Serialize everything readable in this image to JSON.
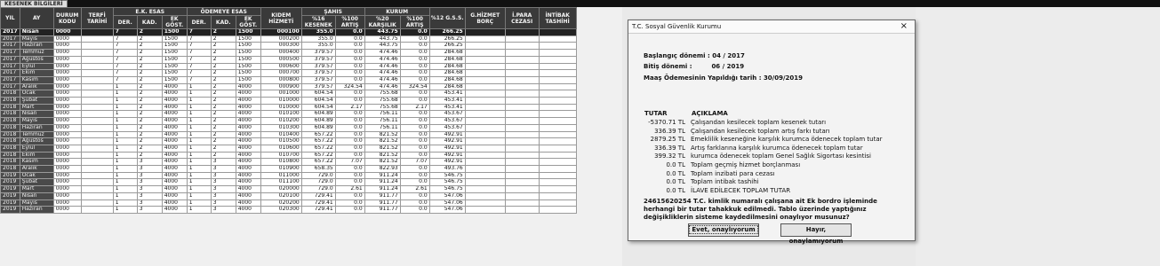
{
  "tab_label": "KESENEK BİLGİLERİ",
  "grid": {
    "group_headers": {
      "ek_esas": "E.K. ESAS",
      "odemeye_esas": "ÖDEMEYE ESAS",
      "sahis": "ŞAHIS",
      "kurum": "KURUM"
    },
    "columns": [
      "YIL",
      "AY",
      "DURUM KODU",
      "TERFİ TARİHİ",
      "DER.",
      "KAD.",
      "EK GÖST.",
      "DER.",
      "KAD.",
      "EK GÖST.",
      "KIDEM HİZMETİ",
      "%16 KESENEK",
      "%100 ARTIŞ",
      "%20 KARŞILIK",
      "%100 ARTIŞ",
      "%12 G.S.S.",
      "G.HİZMET BORÇ",
      "İ.PARA CEZASI",
      "İNTİBAK TASHİHİ"
    ],
    "rows": [
      [
        "2017",
        "Nisan",
        "0000",
        "",
        "7",
        "2",
        "1500",
        "7",
        "2",
        "1500",
        "000100",
        "355.0",
        "0.0",
        "443.75",
        "0.0",
        "266.25",
        "",
        "",
        ""
      ],
      [
        "2017",
        "Mayıs",
        "0000",
        "",
        "7",
        "2",
        "1500",
        "7",
        "2",
        "1500",
        "000200",
        "355.0",
        "0.0",
        "443.75",
        "0.0",
        "266.25",
        "",
        "",
        ""
      ],
      [
        "2017",
        "Haziran",
        "0000",
        "",
        "7",
        "2",
        "1500",
        "7",
        "2",
        "1500",
        "000300",
        "355.0",
        "0.0",
        "443.75",
        "0.0",
        "266.25",
        "",
        "",
        ""
      ],
      [
        "2017",
        "Temmuz",
        "0000",
        "",
        "7",
        "2",
        "1500",
        "7",
        "2",
        "1500",
        "000400",
        "379.57",
        "0.0",
        "474.46",
        "0.0",
        "284.68",
        "",
        "",
        ""
      ],
      [
        "2017",
        "Ağustos",
        "0000",
        "",
        "7",
        "2",
        "1500",
        "7",
        "2",
        "1500",
        "000500",
        "379.57",
        "0.0",
        "474.46",
        "0.0",
        "284.68",
        "",
        "",
        ""
      ],
      [
        "2017",
        "Eylül",
        "0000",
        "",
        "7",
        "2",
        "1500",
        "7",
        "2",
        "1500",
        "000600",
        "379.57",
        "0.0",
        "474.46",
        "0.0",
        "284.68",
        "",
        "",
        ""
      ],
      [
        "2017",
        "Ekim",
        "0000",
        "",
        "7",
        "2",
        "1500",
        "7",
        "2",
        "1500",
        "000700",
        "379.57",
        "0.0",
        "474.46",
        "0.0",
        "284.68",
        "",
        "",
        ""
      ],
      [
        "2017",
        "Kasım",
        "0000",
        "",
        "7",
        "2",
        "1500",
        "7",
        "2",
        "1500",
        "000800",
        "379.57",
        "0.0",
        "474.46",
        "0.0",
        "284.68",
        "",
        "",
        ""
      ],
      [
        "2017",
        "Aralık",
        "0000",
        "",
        "1",
        "2",
        "4000",
        "1",
        "2",
        "4000",
        "000900",
        "379.57",
        "324.54",
        "474.46",
        "324.54",
        "284.68",
        "",
        "",
        ""
      ],
      [
        "2018",
        "Ocak",
        "0000",
        "",
        "1",
        "2",
        "4000",
        "1",
        "2",
        "4000",
        "001000",
        "604.54",
        "0.0",
        "755.68",
        "0.0",
        "453.41",
        "",
        "",
        ""
      ],
      [
        "2018",
        "Şubat",
        "0000",
        "",
        "1",
        "2",
        "4000",
        "1",
        "2",
        "4000",
        "010000",
        "604.54",
        "0.0",
        "755.68",
        "0.0",
        "453.41",
        "",
        "",
        ""
      ],
      [
        "2018",
        "Mart",
        "0000",
        "",
        "1",
        "2",
        "4000",
        "1",
        "2",
        "4000",
        "010000",
        "604.54",
        "2.17",
        "755.68",
        "2.17",
        "453.41",
        "",
        "",
        ""
      ],
      [
        "2018",
        "Nisan",
        "0000",
        "",
        "1",
        "2",
        "4000",
        "1",
        "2",
        "4000",
        "010100",
        "604.89",
        "0.0",
        "756.11",
        "0.0",
        "453.67",
        "",
        "",
        ""
      ],
      [
        "2018",
        "Mayıs",
        "0000",
        "",
        "1",
        "2",
        "4000",
        "1",
        "2",
        "4000",
        "010200",
        "604.89",
        "0.0",
        "756.11",
        "0.0",
        "453.67",
        "",
        "",
        ""
      ],
      [
        "2018",
        "Haziran",
        "0000",
        "",
        "1",
        "2",
        "4000",
        "1",
        "2",
        "4000",
        "010300",
        "604.89",
        "0.0",
        "756.11",
        "0.0",
        "453.67",
        "",
        "",
        ""
      ],
      [
        "2018",
        "Temmuz",
        "0000",
        "",
        "1",
        "2",
        "4000",
        "1",
        "2",
        "4000",
        "010400",
        "657.22",
        "0.0",
        "821.52",
        "0.0",
        "492.91",
        "",
        "",
        ""
      ],
      [
        "2018",
        "Ağustos",
        "0000",
        "",
        "1",
        "2",
        "4000",
        "1",
        "2",
        "4000",
        "010500",
        "657.22",
        "0.0",
        "821.52",
        "0.0",
        "492.91",
        "",
        "",
        ""
      ],
      [
        "2018",
        "Eylül",
        "0000",
        "",
        "1",
        "2",
        "4000",
        "1",
        "2",
        "4000",
        "010600",
        "657.22",
        "0.0",
        "821.52",
        "0.0",
        "492.91",
        "",
        "",
        ""
      ],
      [
        "2018",
        "Ekim",
        "0000",
        "",
        "1",
        "2",
        "4000",
        "1",
        "2",
        "4000",
        "010700",
        "657.22",
        "0.0",
        "821.52",
        "0.0",
        "492.91",
        "",
        "",
        ""
      ],
      [
        "2018",
        "Kasım",
        "0000",
        "",
        "1",
        "3",
        "4000",
        "1",
        "3",
        "4000",
        "010800",
        "657.22",
        "7.07",
        "821.52",
        "7.07",
        "492.91",
        "",
        "",
        ""
      ],
      [
        "2018",
        "Aralık",
        "0000",
        "",
        "1",
        "3",
        "4000",
        "1",
        "3",
        "4000",
        "010900",
        "658.35",
        "0.0",
        "822.93",
        "0.0",
        "493.76",
        "",
        "",
        ""
      ],
      [
        "2019",
        "Ocak",
        "0000",
        "",
        "1",
        "3",
        "4000",
        "1",
        "3",
        "4000",
        "011000",
        "729.0",
        "0.0",
        "911.24",
        "0.0",
        "546.75",
        "",
        "",
        ""
      ],
      [
        "2019",
        "Şubat",
        "0000",
        "",
        "1",
        "3",
        "4000",
        "1",
        "3",
        "4000",
        "011100",
        "729.0",
        "0.0",
        "911.24",
        "0.0",
        "546.75",
        "",
        "",
        ""
      ],
      [
        "2019",
        "Mart",
        "0000",
        "",
        "1",
        "3",
        "4000",
        "1",
        "3",
        "4000",
        "020000",
        "729.0",
        "2.61",
        "911.24",
        "2.61",
        "546.75",
        "",
        "",
        ""
      ],
      [
        "2019",
        "Nisan",
        "0000",
        "",
        "1",
        "3",
        "4000",
        "1",
        "3",
        "4000",
        "020100",
        "729.41",
        "0.0",
        "911.77",
        "0.0",
        "547.06",
        "",
        "",
        ""
      ],
      [
        "2019",
        "Mayıs",
        "0000",
        "",
        "1",
        "3",
        "4000",
        "1",
        "3",
        "4000",
        "020200",
        "729.41",
        "0.0",
        "911.77",
        "0.0",
        "547.06",
        "",
        "",
        ""
      ],
      [
        "2019",
        "Haziran",
        "0000",
        "",
        "1",
        "3",
        "4000",
        "1",
        "3",
        "4000",
        "020300",
        "729.41",
        "0.0",
        "911.77",
        "0.0",
        "547.06",
        "",
        "",
        ""
      ]
    ]
  },
  "dialog": {
    "title": "T.C. Sosyal Güvenlik Kurumu",
    "close_glyph": "×",
    "start_label": "Başlangıç dönemi :",
    "start_value": "04 / 2017",
    "end_label": "Bitiş dönemi :",
    "end_value": "06 / 2019",
    "pay_label": "Maaş Ödemesinin Yapıldığı tarih :",
    "pay_value": "30/09/2019",
    "col_amount": "TUTAR",
    "col_desc": "AÇIKLAMA",
    "items": [
      {
        "amount": "-5370.71 TL",
        "desc": "Çalışandan kesilecek toplam kesenek tutarı"
      },
      {
        "amount": "336.39 TL",
        "desc": "Çalışandan kesilecek toplam artış farkı tutarı"
      },
      {
        "amount": "2879.25 TL",
        "desc": "Emeklilik keseneğine karşılık kurumca ödenecek toplam tutar"
      },
      {
        "amount": "336.39 TL",
        "desc": "Artış farklarına karşılık kurumca ödenecek toplam tutar"
      },
      {
        "amount": "399.32 TL",
        "desc": "kurumca ödenecek toplam Genel Sağlık Sigortası kesintisi"
      },
      {
        "amount": "0.0 TL",
        "desc": "Toplam geçmiş hizmet borçlanması"
      },
      {
        "amount": "0.0 TL",
        "desc": "Toplam inzibati para cezası"
      },
      {
        "amount": "0.0 TL",
        "desc": "Toplam intibak tashihi"
      },
      {
        "amount": "0.0 TL",
        "desc": "İLAVE EDİLECEK TOPLAM TUTAR"
      }
    ],
    "confirm_text": "24615620254 T.C. kimlik numaralı çalışana ait Ek bordro işleminde herhangi bir tutar tahakkuk edilmedi. Tablo üzerinde yaptığınız değişikliklerin sisteme kaydedilmesini onaylıyor musunuz?",
    "yes_label": "Evet, onaylıyorum",
    "no_label": "Hayır, onaylamıyorum"
  }
}
